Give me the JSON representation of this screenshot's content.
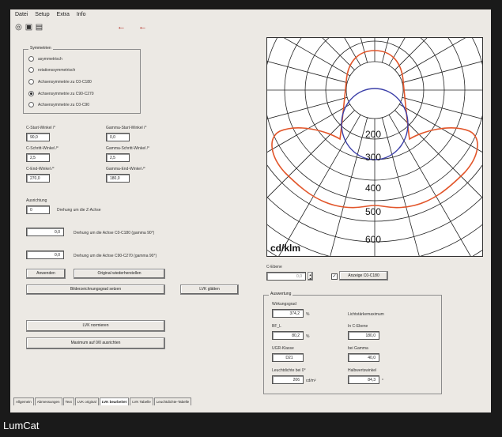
{
  "menu": [
    "Datei",
    "Setup",
    "Extra",
    "Info"
  ],
  "toolbar": {
    "icons": [
      "open-icon",
      "print-icon",
      "save-icon"
    ],
    "nav": [
      "←",
      "←"
    ],
    "accent": "#b0251b"
  },
  "symmetrie": {
    "title": "Symmetrien",
    "options": [
      "asymmetrisch",
      "rotationssymmetrisch",
      "Achsensymmetrie zu C0-C180",
      "Achsensymmetrie zu C90-C270",
      "Achsensymmetrie zu C0-C90"
    ],
    "selected": 3
  },
  "angles": {
    "c_start_label": "C-Start-Winkel /°",
    "c_start_value": "90,0",
    "gamma_start_label": "Gamma-Start-Winkel /°",
    "gamma_start_value": "0,0",
    "c_step_label": "C-Schritt-Winkel /°",
    "c_step_value": "2,5",
    "gamma_step_label": "Gamma-Schritt-Winkel /°",
    "gamma_step_value": "2,5",
    "c_end_label": "C-End-Winkel /°",
    "c_end_value": "270,0",
    "gamma_end_label": "Gamma-End-Winkel /°",
    "gamma_end_value": "180,0"
  },
  "ausrichtung": {
    "label": "Ausrichtung",
    "value": "0",
    "note": "Drehung um die Z-Achse"
  },
  "rotation1": {
    "value": "0,0",
    "label": "Drehung um die Achse C0-C180 (gamma 90°)"
  },
  "rotation2": {
    "value": "0,0",
    "label": "Drehung um die Achse C90-C270 (gamma 90°)"
  },
  "buttons": {
    "anwenden": "Anwenden",
    "original": "Original wiederherstellen",
    "bilder": "Bilderzeichnungsgrad setzen",
    "ldt_glaetten": "LVK glätten",
    "ldt_normieren": "LVK normieren",
    "maximum": "Maximum auf 0/0 ausrichten"
  },
  "cebene": {
    "label": "C-Ebene",
    "value": "0,0",
    "check_label": "Anzeige C0-C180",
    "checked": true
  },
  "auswertung": {
    "title": "Auswertung",
    "wirkungsgrad_label": "Wirkungsgrad",
    "wirkungsgrad_value": "374,2",
    "wirkungsgrad_unit": "%",
    "lichtstaerken_label": "Lichtstärkemaximum",
    "bf_label": "BF_L",
    "bf_value": "80,2",
    "bf_unit": "%",
    "in_cebene_label": "In C-Ebene",
    "in_cebene_value": "180,0",
    "ugr_label": "UGR-Klasse",
    "ugr_value": "D21",
    "bei_gamma_label": "bei Gamma",
    "bei_gamma_value": "40,0",
    "leuchtdichte_label": "Leuchtdichte bei 0°",
    "leuchtdichte_value": "206",
    "leuchtdichte_unit": "cd/m²",
    "halbwert_label": "Halbwertswinkel",
    "halbwert_value": "84,3",
    "halbwert_unit": "°"
  },
  "polar": {
    "labels": [
      "200",
      "300",
      "400",
      "500",
      "600"
    ],
    "unit": "cd/klm",
    "series_colors": {
      "c0_c180": "#e2562b",
      "c90_c270": "#3b3fa8"
    }
  },
  "tabs": [
    "Allgemein",
    "Abmessungen",
    "Text",
    "LVK original",
    "LVK bearbeitet",
    "LVK Tabelle",
    "Leuchtdichte-Tabelle"
  ],
  "active_tab": 4,
  "caption": "LumCat"
}
